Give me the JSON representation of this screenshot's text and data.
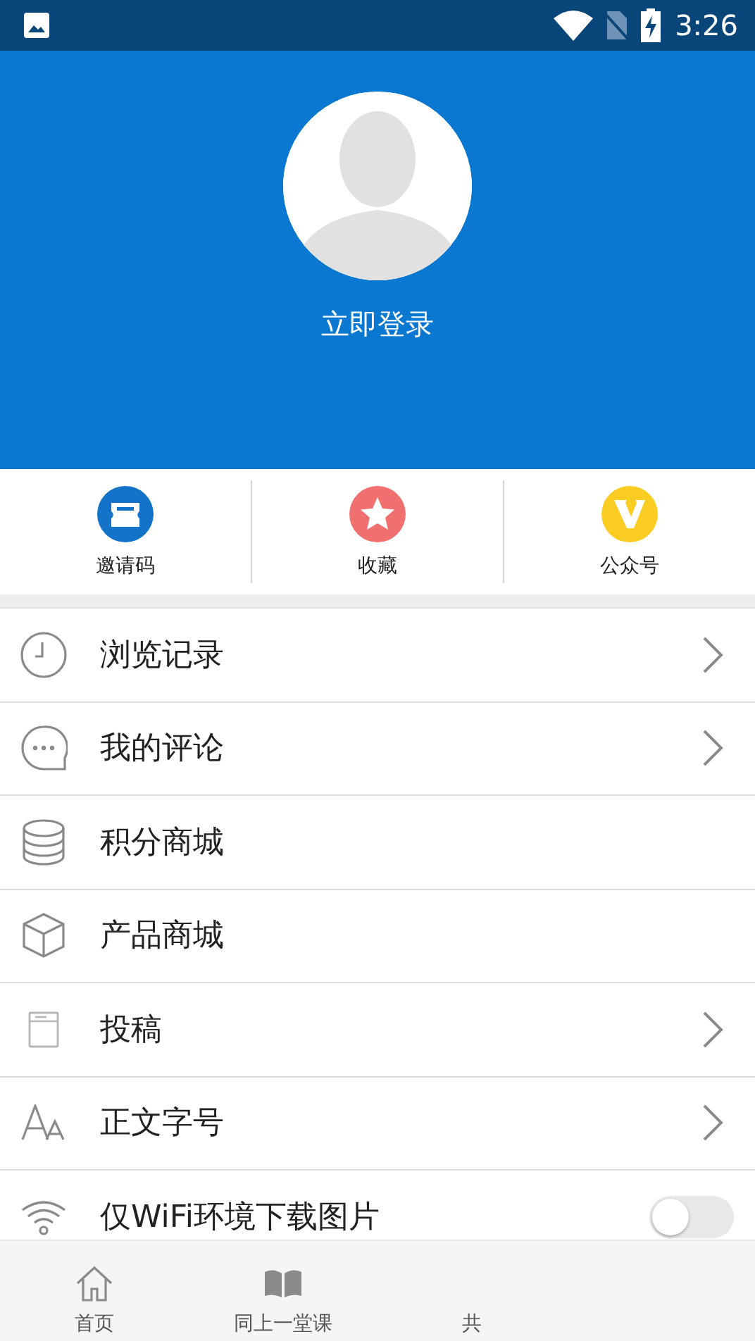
{
  "status_bar": {
    "time": "3:26"
  },
  "profile": {
    "login": "立即登录"
  },
  "shortcuts": [
    {
      "label": "邀请码",
      "color": "#1473c8"
    },
    {
      "label": "收藏",
      "color": "#f07070"
    },
    {
      "label": "公众号",
      "color": "#fbcd22"
    }
  ],
  "menu": [
    {
      "label": "浏览记录",
      "kind": "arrow"
    },
    {
      "label": "我的评论",
      "kind": "arrow"
    },
    {
      "label": "积分商城",
      "kind": "plain"
    },
    {
      "label": "产品商城",
      "kind": "plain"
    },
    {
      "label": "投稿",
      "kind": "arrow"
    },
    {
      "label": "正文字号",
      "kind": "arrow"
    },
    {
      "label": "仅WiFi环境下载图片",
      "kind": "toggle",
      "on": false
    }
  ],
  "tab_bar": [
    {
      "label": "首页"
    },
    {
      "label": "同上一堂课"
    },
    {
      "label": "共"
    }
  ]
}
